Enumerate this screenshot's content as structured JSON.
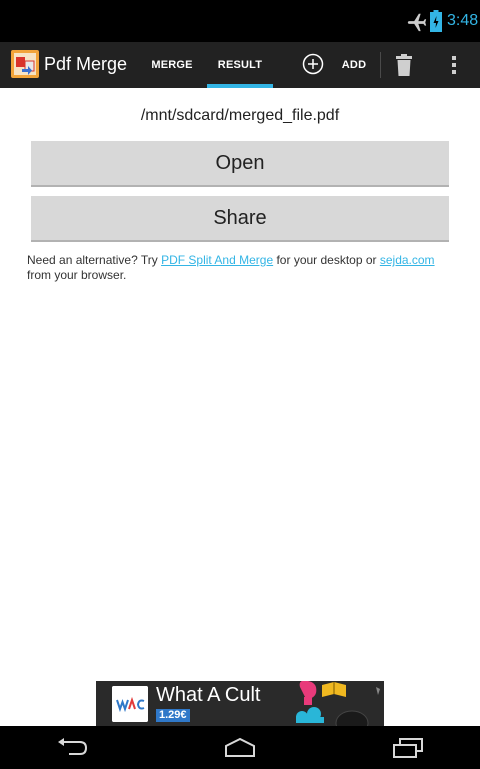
{
  "status_bar": {
    "time": "3:48"
  },
  "action_bar": {
    "title": "Pdf Merge",
    "tabs": [
      {
        "label": "MERGE",
        "selected": false
      },
      {
        "label": "RESULT",
        "selected": true
      }
    ],
    "add_label": "ADD"
  },
  "content": {
    "file_path": "/mnt/sdcard/merged_file.pdf",
    "open_label": "Open",
    "share_label": "Share",
    "info": {
      "prefix": "Need an alternative? Try ",
      "link1": "PDF Split And Merge",
      "middle": " for your desktop or ",
      "link2": "sejda.com",
      "suffix": " from your browser."
    }
  },
  "ad": {
    "title": "What A Cult",
    "price": "1.29€"
  },
  "colors": {
    "accent": "#33b5e5",
    "action_bar": "#222222",
    "button": "#d8d8d8"
  },
  "icons": [
    "airplane-icon",
    "battery-icon",
    "app-icon",
    "add-circle-icon",
    "trash-icon",
    "overflow-menu-icon",
    "back-icon",
    "home-icon",
    "recents-icon"
  ]
}
